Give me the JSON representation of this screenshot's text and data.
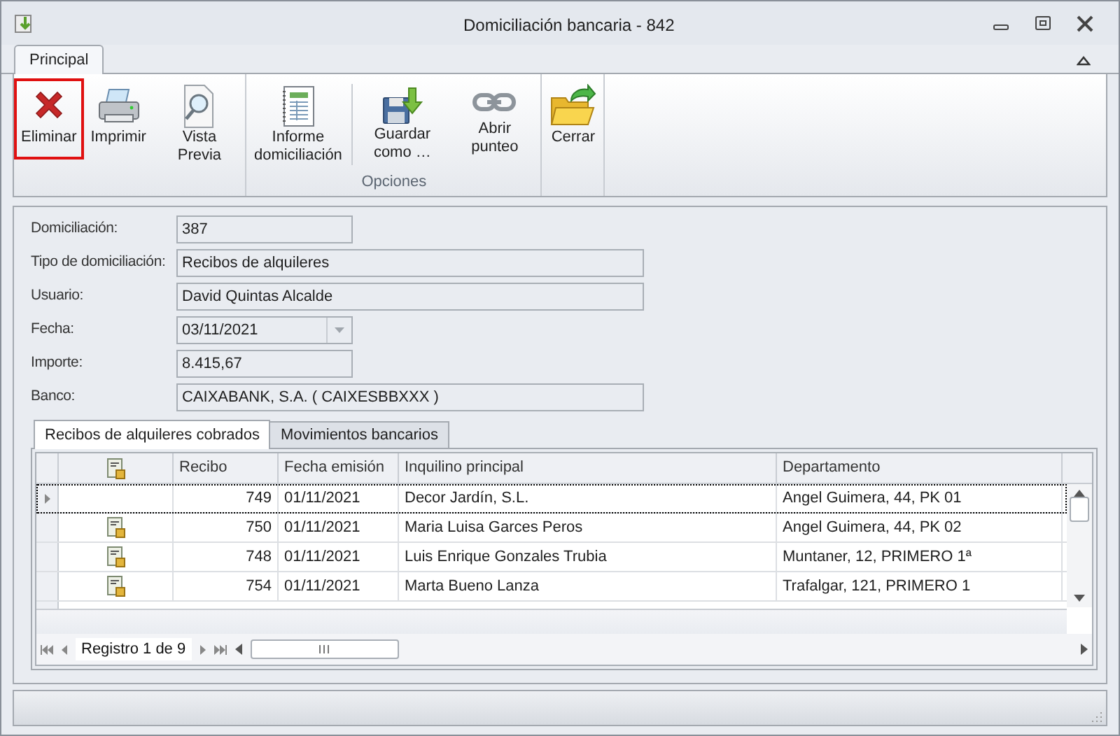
{
  "window": {
    "title": "Domiciliación bancaria - 842"
  },
  "ribbon": {
    "tabs": [
      {
        "label": "Principal",
        "selected": true
      }
    ],
    "groups": [
      {
        "buttons": [
          {
            "label": "Eliminar",
            "selected": true
          },
          {
            "label": "Imprimir",
            "selected": false
          },
          {
            "label": "Vista Previa",
            "selected": false
          }
        ]
      },
      {
        "label": "Opciones",
        "buttons": [
          {
            "label": "Informe domiciliación",
            "selected": false
          },
          {
            "label": "Guardar como …",
            "selected": false
          },
          {
            "label": "Abrir punteo",
            "selected": false
          }
        ]
      },
      {
        "buttons": [
          {
            "label": "Cerrar",
            "selected": false
          }
        ]
      }
    ]
  },
  "form": [
    {
      "label": "Domiciliación:",
      "value": "387",
      "kind": "short"
    },
    {
      "label": "Tipo de domiciliación:",
      "value": "Recibos de alquileres",
      "kind": "long"
    },
    {
      "label": "Usuario:",
      "value": "David Quintas Alcalde",
      "kind": "long"
    },
    {
      "label": "Fecha:",
      "value": "03/11/2021",
      "kind": "date"
    },
    {
      "label": "Importe:",
      "value": "8.415,67",
      "kind": "short"
    },
    {
      "label": "Banco:",
      "value": "CAIXABANK, S.A. ( CAIXESBBXXX )",
      "kind": "long"
    }
  ],
  "tabs": [
    {
      "label": "Recibos de alquileres cobrados",
      "selected": true
    },
    {
      "label": "Movimientos bancarios",
      "selected": false
    }
  ],
  "table": {
    "columns": [
      "Recibo",
      "Fecha emisión",
      "Inquilino principal",
      "Departamento"
    ],
    "rows": [
      {
        "current": true,
        "has_icon": false,
        "cells": [
          "749",
          "01/11/2021",
          "Decor Jardín, S.L.",
          "Angel Guimera, 44, PK 01"
        ]
      },
      {
        "current": false,
        "has_icon": true,
        "cells": [
          "750",
          "01/11/2021",
          "Maria Luisa Garces Peros",
          "Angel Guimera, 44, PK 02"
        ]
      },
      {
        "current": false,
        "has_icon": true,
        "cells": [
          "748",
          "01/11/2021",
          "Luis Enrique Gonzales Trubia",
          "Muntaner, 12, PRIMERO 1ª"
        ]
      },
      {
        "current": false,
        "has_icon": true,
        "cells": [
          "754",
          "01/11/2021",
          "Marta Bueno Lanza",
          "Trafalgar, 121, PRIMERO 1"
        ]
      }
    ]
  },
  "navigator": {
    "text": "Registro 1 de 9"
  }
}
